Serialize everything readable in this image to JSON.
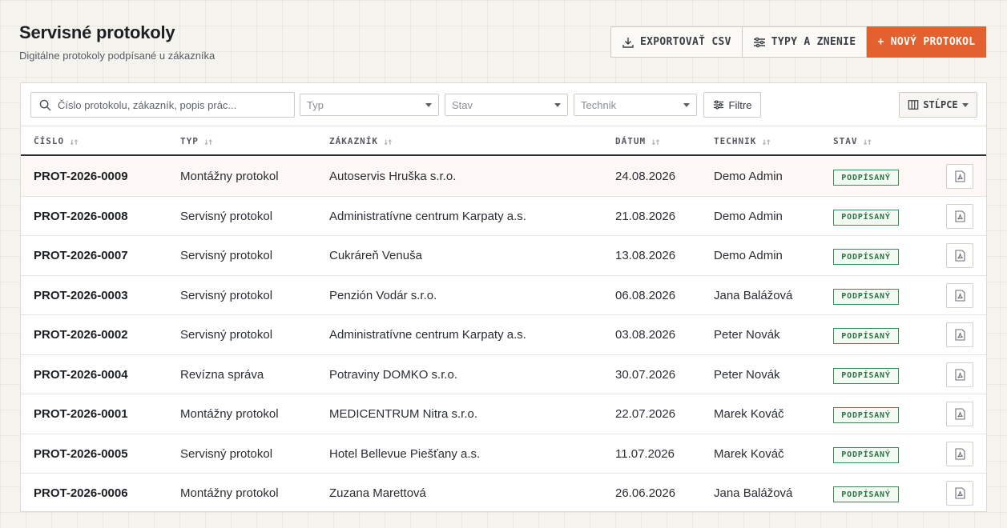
{
  "header": {
    "title": "Servisné protokoly",
    "subtitle": "Digitálne protokoly podpísané u zákazníka",
    "export_label": "EXPORTOVAŤ CSV",
    "types_label": "TYPY A ZNENIE",
    "new_label": "+ NOVÝ PROTOKOL"
  },
  "colors": {
    "accent": "#e2612f",
    "signed": "#2d7443"
  },
  "toolbar": {
    "search_placeholder": "Číslo protokolu, zákazník, popis prác...",
    "type_placeholder": "Typ",
    "state_placeholder": "Stav",
    "tech_placeholder": "Technik",
    "filter_label": "Filtre",
    "columns_label": "STĹPCE"
  },
  "table": {
    "columns": [
      "ČÍSLO",
      "TYP",
      "ZÁKAZNÍK",
      "DÁTUM",
      "TECHNIK",
      "STAV"
    ],
    "rows": [
      {
        "number": "PROT-2026-0009",
        "type": "Montážny protokol",
        "customer": "Autoservis Hruška s.r.o.",
        "date": "24.08.2026",
        "technician": "Demo Admin",
        "status": "PODPÍSANÝ"
      },
      {
        "number": "PROT-2026-0008",
        "type": "Servisný protokol",
        "customer": "Administratívne centrum Karpaty a.s.",
        "date": "21.08.2026",
        "technician": "Demo Admin",
        "status": "PODPÍSANÝ"
      },
      {
        "number": "PROT-2026-0007",
        "type": "Servisný protokol",
        "customer": "Cukráreň Venuša",
        "date": "13.08.2026",
        "technician": "Demo Admin",
        "status": "PODPÍSANÝ"
      },
      {
        "number": "PROT-2026-0003",
        "type": "Servisný protokol",
        "customer": "Penzión Vodár s.r.o.",
        "date": "06.08.2026",
        "technician": "Jana Balážová",
        "status": "PODPÍSANÝ"
      },
      {
        "number": "PROT-2026-0002",
        "type": "Servisný protokol",
        "customer": "Administratívne centrum Karpaty a.s.",
        "date": "03.08.2026",
        "technician": "Peter Novák",
        "status": "PODPÍSANÝ"
      },
      {
        "number": "PROT-2026-0004",
        "type": "Revízna správa",
        "customer": "Potraviny DOMKO s.r.o.",
        "date": "30.07.2026",
        "technician": "Peter Novák",
        "status": "PODPÍSANÝ"
      },
      {
        "number": "PROT-2026-0001",
        "type": "Montážny protokol",
        "customer": "MEDICENTRUM Nitra s.r.o.",
        "date": "22.07.2026",
        "technician": "Marek Kováč",
        "status": "PODPÍSANÝ"
      },
      {
        "number": "PROT-2026-0005",
        "type": "Servisný protokol",
        "customer": "Hotel Bellevue Piešťany a.s.",
        "date": "11.07.2026",
        "technician": "Marek Kováč",
        "status": "PODPÍSANÝ"
      },
      {
        "number": "PROT-2026-0006",
        "type": "Montážny protokol",
        "customer": "Zuzana Marettová",
        "date": "26.06.2026",
        "technician": "Jana Balážová",
        "status": "PODPÍSANÝ"
      }
    ]
  }
}
